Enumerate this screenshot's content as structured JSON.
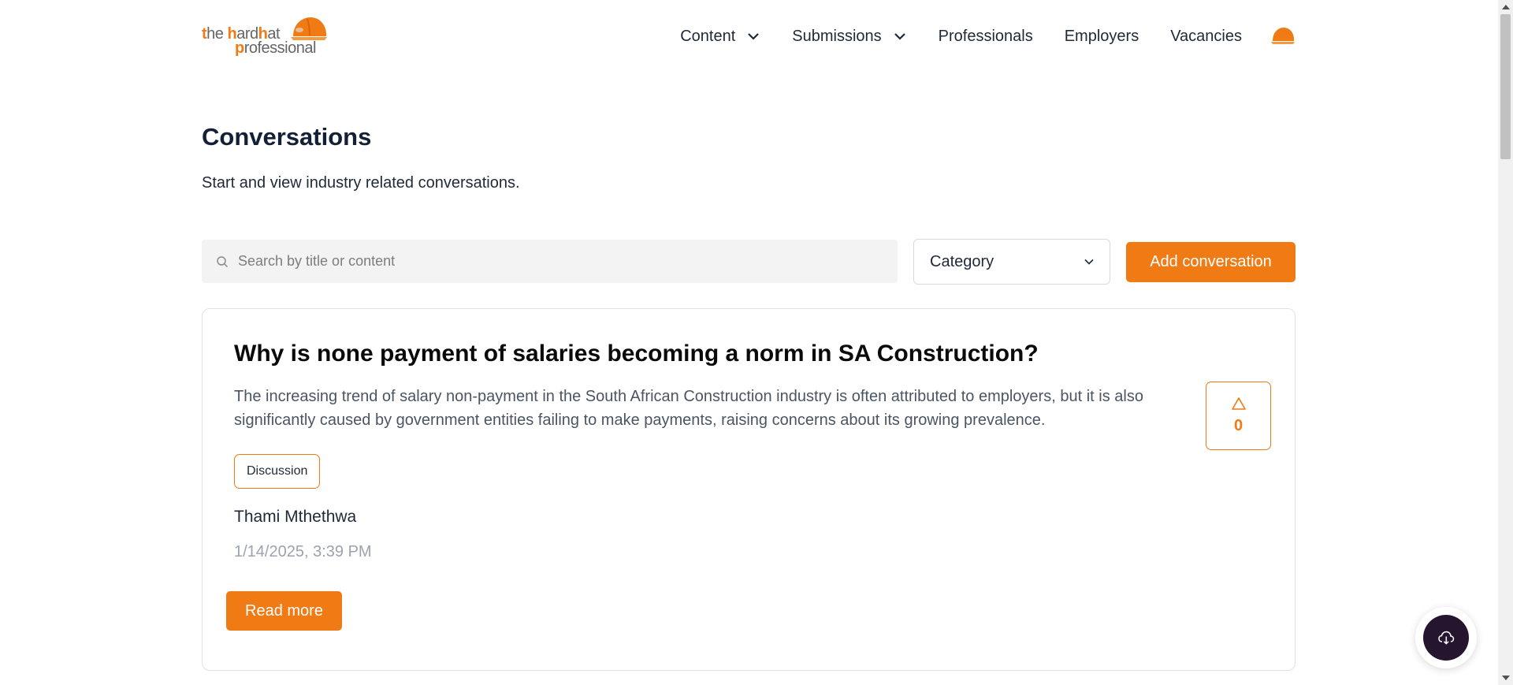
{
  "brand": {
    "logo_line1_prefix": "t",
    "logo_line1_he": "he ",
    "logo_line1_h": "h",
    "logo_line1_ard": "ard",
    "logo_line1_h2": "h",
    "logo_line1_at": "at",
    "logo_line2_p": "p",
    "logo_line2_rest": "rofessional",
    "accent_color": "#f07a14"
  },
  "nav": {
    "items": [
      {
        "label": "Content",
        "has_dropdown": true
      },
      {
        "label": "Submissions",
        "has_dropdown": true
      },
      {
        "label": "Professionals",
        "has_dropdown": false
      },
      {
        "label": "Employers",
        "has_dropdown": false
      },
      {
        "label": "Vacancies",
        "has_dropdown": false
      }
    ],
    "avatar_icon": "hardhat-avatar-icon"
  },
  "page": {
    "title": "Conversations",
    "subtitle": "Start and view industry related conversations."
  },
  "toolbar": {
    "search_placeholder": "Search by title or content",
    "search_value": "",
    "category_value": "Category",
    "add_label": "Add conversation"
  },
  "conversations": [
    {
      "title": "Why is none payment of salaries becoming a norm in SA Construction?",
      "excerpt": "The increasing trend of salary non-payment in the South African Construction industry is often attributed to employers, but it is also significantly caused by government entities failing to make payments, raising concerns about its growing prevalence.",
      "tag": "Discussion",
      "author": "Thami Mthethwa",
      "timestamp": "1/14/2025, 3:39 PM",
      "votes": "0",
      "read_more_label": "Read more"
    }
  ],
  "fab": {
    "icon": "cloud-download-icon"
  }
}
